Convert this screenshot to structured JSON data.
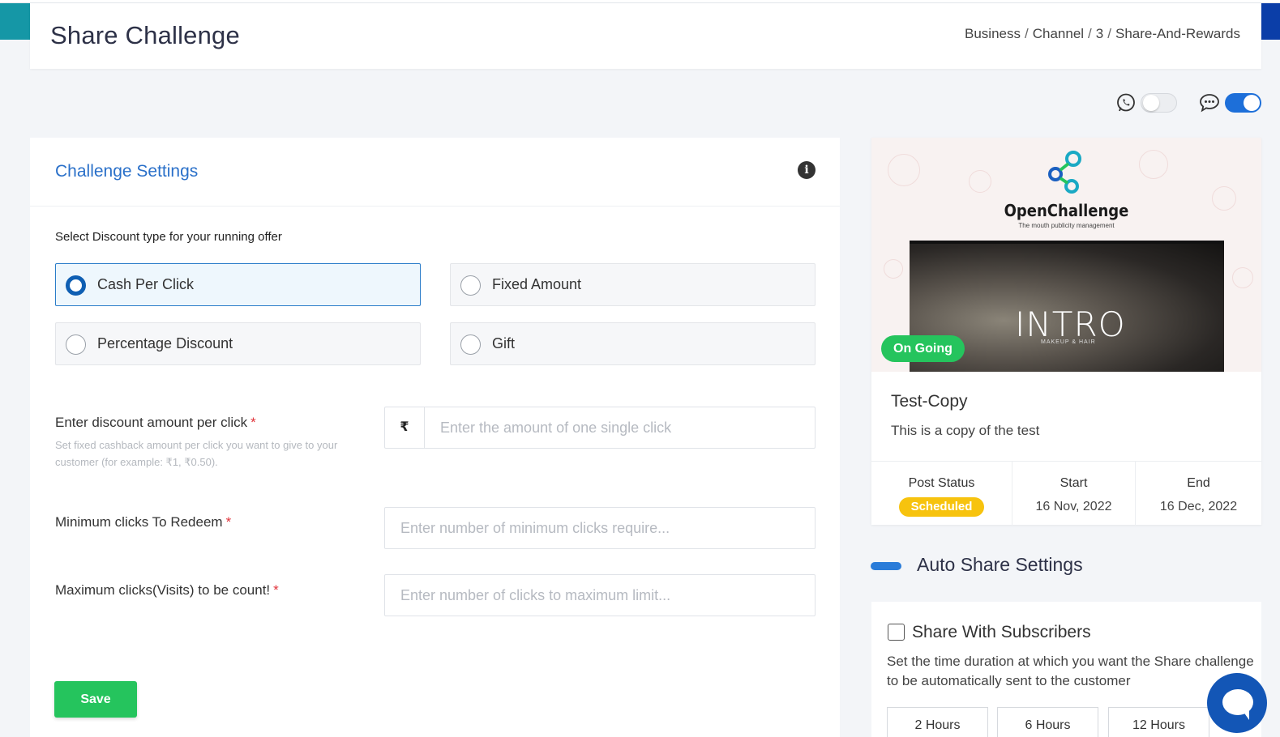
{
  "header": {
    "title": "Share Challenge",
    "breadcrumb": [
      "Business",
      "Channel",
      "3",
      "Share-And-Rewards"
    ],
    "breadcrumb_separator": "/"
  },
  "toggles": {
    "whatsapp": {
      "icon": "whatsapp-icon",
      "enabled": false
    },
    "sms": {
      "icon": "chat-bubble-icon",
      "enabled": true
    }
  },
  "settings": {
    "title": "Challenge Settings",
    "info_icon": "info-icon",
    "select_label": "Select Discount type for your running offer",
    "options": [
      {
        "label": "Cash Per Click",
        "selected": true
      },
      {
        "label": "Fixed Amount",
        "selected": false
      },
      {
        "label": "Percentage Discount",
        "selected": false
      },
      {
        "label": "Gift",
        "selected": false
      }
    ],
    "discount_field": {
      "label": "Enter discount amount per click",
      "required_mark": "*",
      "hint": "Set fixed cashback amount per click you want to give to your customer (for example: ₹1, ₹0.50).",
      "currency_symbol": "₹",
      "placeholder": "Enter the amount of one single click",
      "value": ""
    },
    "min_clicks_field": {
      "label": "Minimum clicks To Redeem",
      "required_mark": "*",
      "placeholder": "Enter number of minimum clicks require...",
      "value": ""
    },
    "max_clicks_field": {
      "label": "Maximum clicks(Visits) to be count!",
      "required_mark": "*",
      "placeholder": "Enter number of clicks to maximum limit...",
      "value": ""
    },
    "save_label": "Save"
  },
  "preview": {
    "brand_name": "OpenChallenge",
    "brand_tagline": "The mouth publicity management",
    "photo_text": "INTRO",
    "photo_subtext": "MAKEUP & HAIR",
    "status_pill": "On Going",
    "title": "Test-Copy",
    "description": "This is a copy of the test",
    "stats": {
      "post_status_label": "Post Status",
      "post_status_value": "Scheduled",
      "start_label": "Start",
      "start_value": "16 Nov, 2022",
      "end_label": "End",
      "end_value": "16 Dec, 2022"
    }
  },
  "auto_share": {
    "title": "Auto Share Settings",
    "share_subscribers_label": "Share With Subscribers",
    "share_subscribers_checked": false,
    "description": "Set the time duration at which you want the Share challenge to be automatically sent to the customer",
    "hours": [
      "2 Hours",
      "6 Hours",
      "12 Hours"
    ]
  },
  "colors": {
    "accent_blue": "#2a70c9",
    "save_green": "#25c45d",
    "scheduled_yellow": "#f7c30e",
    "chat_fab": "#1356b6"
  }
}
